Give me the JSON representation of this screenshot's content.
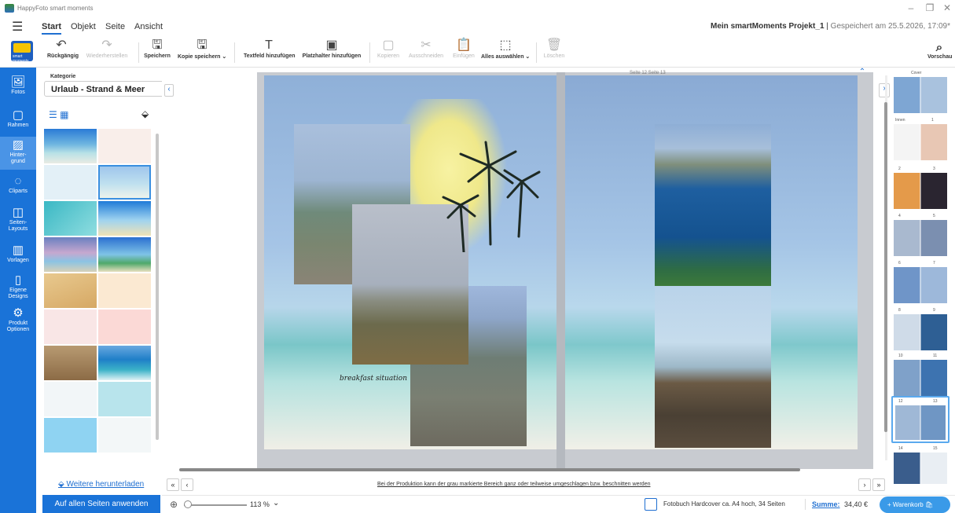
{
  "window": {
    "title": "HappyFoto smart moments",
    "controls": [
      "–",
      "❐",
      "✕"
    ]
  },
  "menu": {
    "items": [
      "Start",
      "Objekt",
      "Seite",
      "Ansicht"
    ],
    "active": "Start",
    "project_name": "Mein smartMoments Projekt_1",
    "saved_text": "Gespeichert am 25.5.2026, 17:09*"
  },
  "toolbar": {
    "logo_text": "smart moments",
    "undo": "Rückgängig",
    "redo": "Wiederherstellen",
    "save": "Speichern",
    "save_copy": "Kopie speichern ⌄",
    "add_textfield": "Textfeld hinzufügen",
    "add_placeholder": "Platzhalter hinzufügen",
    "copy": "Kopieren",
    "cut": "Ausschneiden",
    "paste": "Einfügen",
    "select_all": "Alles auswählen ⌄",
    "delete": "Löschen",
    "preview": "Vorschau"
  },
  "sidebar": {
    "items": [
      {
        "label": "Fotos",
        "icon": "photos-icon"
      },
      {
        "label": "Rahmen",
        "icon": "frame-icon"
      },
      {
        "label": "Hinter-\ngrund",
        "icon": "background-icon"
      },
      {
        "label": "Cliparts",
        "icon": "clipart-icon"
      },
      {
        "label": "Seiten-\nLayouts",
        "icon": "layout-icon"
      },
      {
        "label": "Vorlagen",
        "icon": "templates-icon"
      },
      {
        "label": "Eigene\nDesigns",
        "icon": "own-designs-icon"
      },
      {
        "label": "Produkt\nOptionen",
        "icon": "product-options-icon"
      }
    ],
    "active_index": 2
  },
  "category": {
    "label": "Kategorie",
    "selected": "Urlaub - Strand & Meer",
    "download_link": "Weitere herunterladen",
    "apply_button": "Auf allen Seiten anwenden"
  },
  "canvas": {
    "page_labels": "Seite 12   Seite 13",
    "caption": "breakfast situation",
    "notice": "Bei der Produktion kann der grau markierte Bereich ganz oder teilweise umgeschlagen bzw. beschnitten werden"
  },
  "status": {
    "zoom": "113 %",
    "book_info": "Fotobuch Hardcover ca. A4 hoch, 34 Seiten",
    "sum_label": "Summe:",
    "sum_value": "34,40 €",
    "cart_button": "+ Warenkorb"
  },
  "pagelist": {
    "labels": [
      "Cover",
      "Innen",
      "1",
      "2",
      "3",
      "4",
      "5",
      "6",
      "7",
      "8",
      "9",
      "10",
      "11",
      "12",
      "13",
      "14",
      "15"
    ]
  },
  "colors": {
    "accent": "#1a73d8",
    "sidebar_bg": "#1a73d8",
    "sum_link": "#1f6fd1"
  }
}
